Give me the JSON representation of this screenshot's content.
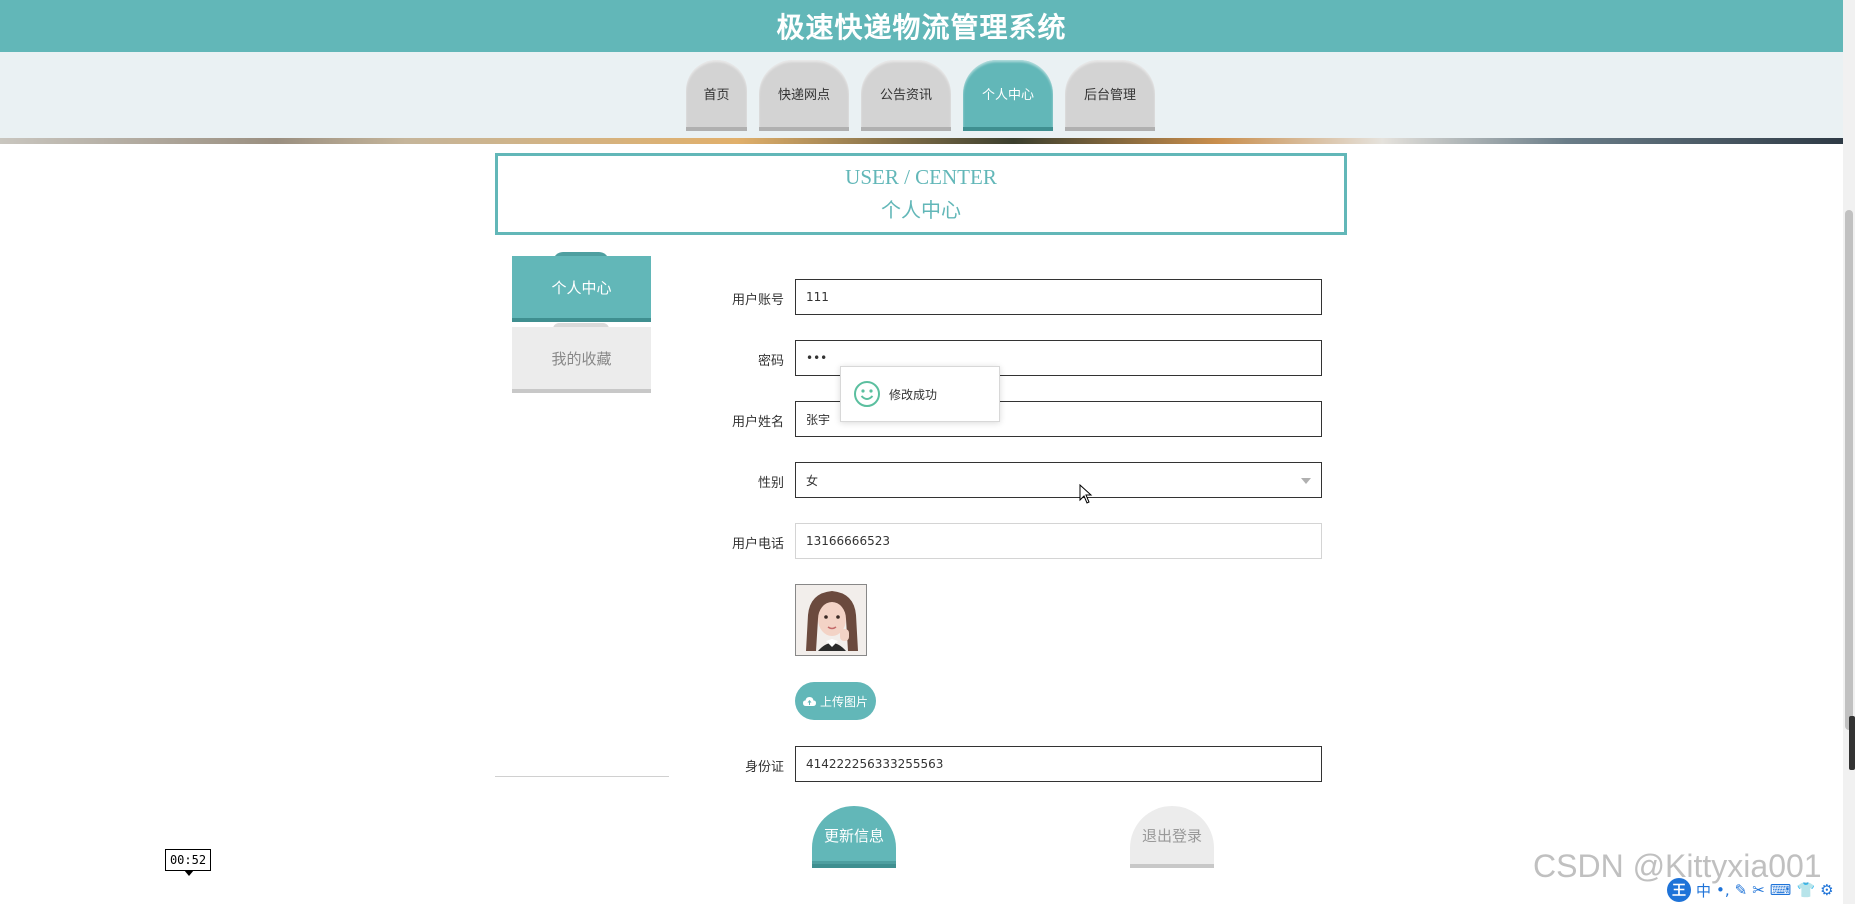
{
  "header": {
    "title": "极速快递物流管理系统"
  },
  "nav": {
    "tabs": [
      {
        "label": "首页"
      },
      {
        "label": "快递网点"
      },
      {
        "label": "公告资讯"
      },
      {
        "label": "个人中心"
      },
      {
        "label": "后台管理"
      }
    ],
    "active": "个人中心"
  },
  "section": {
    "title_en": "USER / CENTER",
    "title_cn": "个人中心"
  },
  "sidebar": {
    "items": [
      {
        "label": "个人中心",
        "active": true
      },
      {
        "label": "我的收藏",
        "active": false
      }
    ]
  },
  "form": {
    "account_label": "用户账号",
    "account_value": "111",
    "password_label": "密码",
    "password_value": "•••",
    "name_label": "用户姓名",
    "name_value": "张宇",
    "gender_label": "性别",
    "gender_value": "女",
    "phone_label": "用户电话",
    "phone_value": "13166666523",
    "upload_label": "上传图片",
    "id_label": "身份证",
    "id_value": "414222256333255563",
    "update_button": "更新信息",
    "logout_button": "退出登录"
  },
  "toast": {
    "message": "修改成功",
    "icon": "smile-icon"
  },
  "overlay": {
    "timer": "00:52",
    "watermark": "CSDN @Kittyxia001",
    "ime_logo": "王",
    "ime_items": [
      "中",
      "•,",
      "✎",
      "✂",
      "⌨",
      "👕",
      "⚙"
    ]
  },
  "colors": {
    "accent": "#62b7b8",
    "accent_dark": "#3f8f90",
    "inactive": "#d3d3d3"
  }
}
